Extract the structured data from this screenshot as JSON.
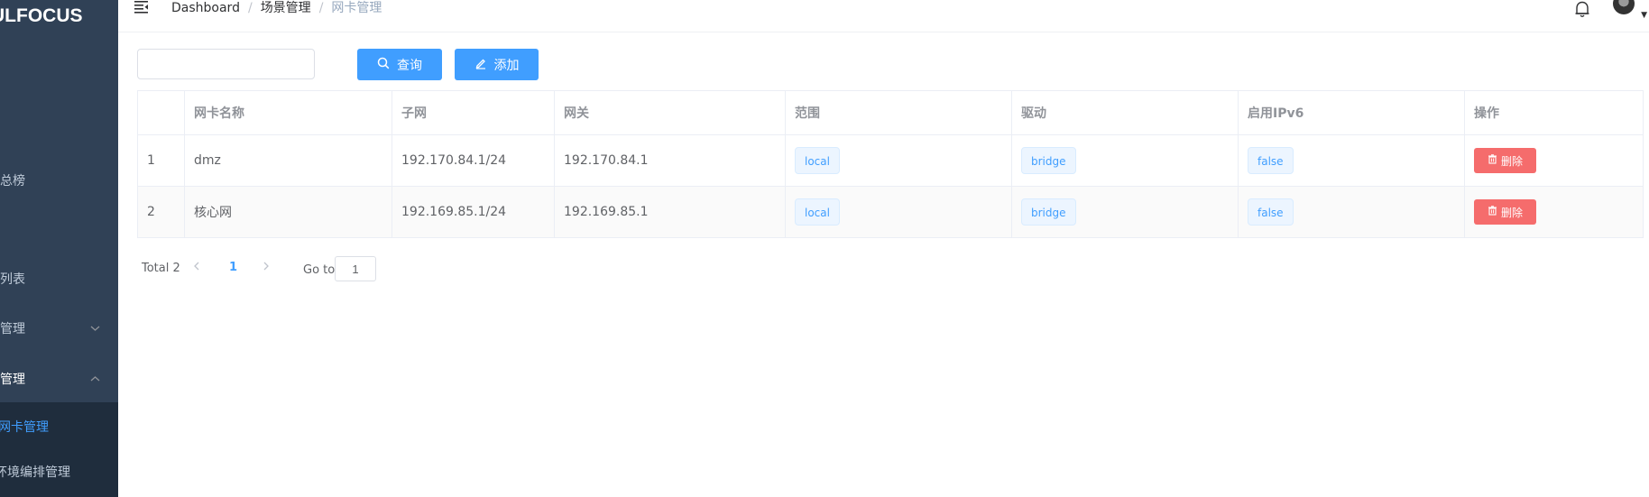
{
  "sidebar": {
    "logo": "ULFOCUS",
    "items": [
      {
        "label": "总榜"
      },
      {
        "label": "列表"
      },
      {
        "label": "管理"
      },
      {
        "label": "管理"
      },
      {
        "label": "网卡管理"
      },
      {
        "label": "环境编排管理"
      }
    ]
  },
  "header": {
    "breadcrumb": [
      "Dashboard",
      "场景管理",
      "网卡管理"
    ],
    "separator": "/"
  },
  "toolbar": {
    "search_value": "",
    "query_label": "查询",
    "add_label": "添加"
  },
  "table": {
    "columns": [
      "",
      "网卡名称",
      "子网",
      "网关",
      "范围",
      "驱动",
      "启用IPv6",
      "操作"
    ],
    "rows": [
      {
        "index": "1",
        "name": "dmz",
        "subnet": "192.170.84.1/24",
        "gateway": "192.170.84.1",
        "scope": "local",
        "driver": "bridge",
        "ipv6": "false",
        "action": "删除"
      },
      {
        "index": "2",
        "name": "核心网",
        "subnet": "192.169.85.1/24",
        "gateway": "192.169.85.1",
        "scope": "local",
        "driver": "bridge",
        "ipv6": "false",
        "action": "删除"
      }
    ]
  },
  "pagination": {
    "total": "Total 2",
    "current_page": "1",
    "goto_label": "Go to",
    "goto_value": "1"
  },
  "colors": {
    "sidebar_bg": "#304156",
    "primary": "#409eff",
    "danger": "#f56c6c"
  }
}
